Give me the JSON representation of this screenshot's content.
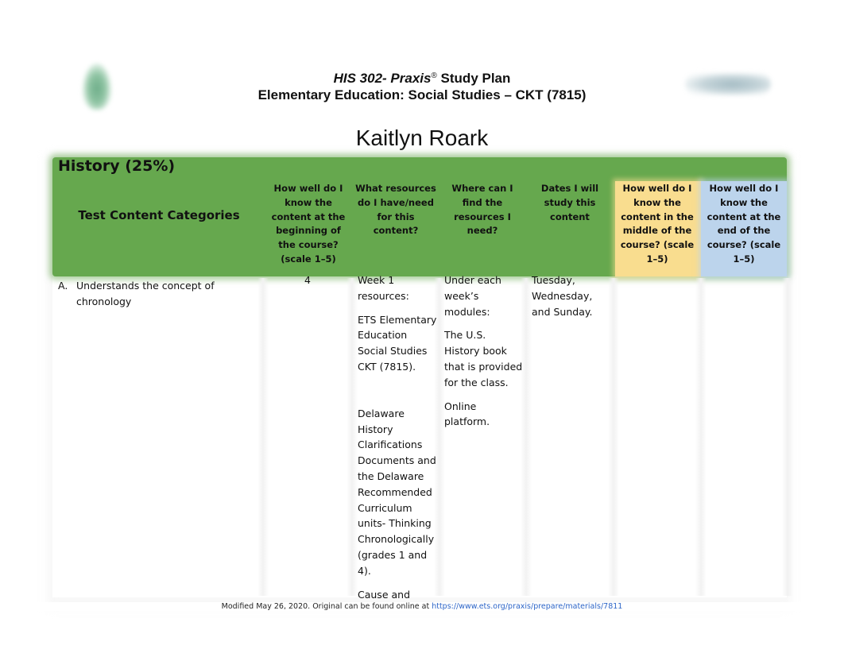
{
  "header": {
    "course_code": "HIS 302- ",
    "exam_name": "Praxis",
    "registered_mark": "®",
    "title_suffix": " Study Plan",
    "subtitle": "Elementary Education: Social Studies – CKT (7815)",
    "student_name": "Kaitlyn Roark"
  },
  "logos": {
    "left": "school-logo",
    "right": "partner-logo"
  },
  "colors": {
    "header_green": "#66a84e",
    "middle_yellow": "#f9dd8f",
    "end_blue": "#bcd4ec",
    "link_blue": "#2e66c8"
  },
  "section": {
    "title": "History (25%)",
    "columns": [
      "Test Content Categories",
      "How well do I know the content at the beginning of the course? (scale 1–5)",
      "What resources do I have/need for this content?",
      "Where can I find the resources I need?",
      "Dates I will study this content",
      "How well do I know the content in the middle of the course? (scale 1–5)",
      "How well do I know the content at the end of the course? (scale 1–5)"
    ],
    "rows": [
      {
        "letter": "A.",
        "category": "Understands the concept of chronology",
        "score_beginning": "4",
        "resources": [
          "Week 1 resources:",
          "ETS Elementary Education Social Studies CKT (7815).",
          "",
          "Delaware History Clarifications Documents and the Delaware Recommended Curriculum units- Thinking Chronologically (grades 1 and 4).",
          "Cause and"
        ],
        "locations": [
          "Under each week’s modules:",
          "The U.S. History book that is provided for the class.",
          "Online platform."
        ],
        "dates": "Tuesday, Wednesday, and Sunday.",
        "score_middle": "",
        "score_end": ""
      }
    ]
  },
  "footer": {
    "text": "Modified May 26, 2020.  Original can be found online at ",
    "link": "https://www.ets.org/praxis/prepare/materials/7811"
  }
}
